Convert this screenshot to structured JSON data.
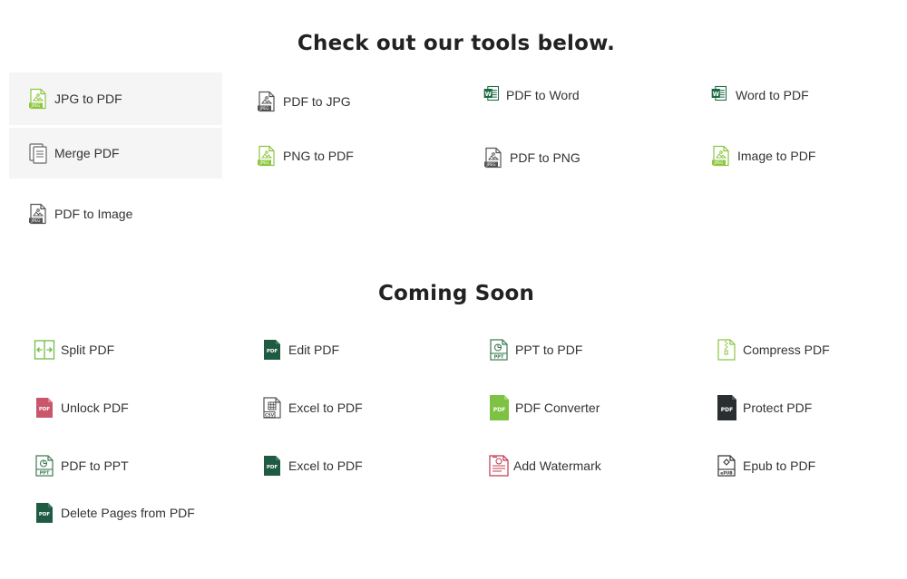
{
  "tools_heading": "Check out our tools below.",
  "soon_heading": "Coming Soon",
  "tools": [
    {
      "label": "JPG to PDF",
      "icon": "jpeg-file-icon"
    },
    {
      "label": "PDF to JPG",
      "icon": "jpeg-file-icon"
    },
    {
      "label": "PDF to Word",
      "icon": "word-doc-icon"
    },
    {
      "label": "Word to PDF",
      "icon": "word-doc-icon"
    },
    {
      "label": "Merge PDF",
      "icon": "merge-documents-icon"
    },
    {
      "label": "PNG to PDF",
      "icon": "jpeg-file-icon"
    },
    {
      "label": "PDF to PNG",
      "icon": "jpeg-file-icon"
    },
    {
      "label": "Image to PDF",
      "icon": "jpeg-file-icon"
    },
    {
      "label": "PDF to Image",
      "icon": "jpeg-file-icon"
    }
  ],
  "coming_soon": [
    {
      "label": "Split PDF",
      "icon": "split-arrows-icon"
    },
    {
      "label": "Edit PDF",
      "icon": "pdf-file-icon"
    },
    {
      "label": "PPT to PDF",
      "icon": "ppt-file-icon"
    },
    {
      "label": "Compress PDF",
      "icon": "zip-file-icon"
    },
    {
      "label": "Unlock PDF",
      "icon": "pdf-file-icon"
    },
    {
      "label": "Excel to PDF",
      "icon": "excel-sheet-icon"
    },
    {
      "label": "PDF Converter",
      "icon": "pdf-file-icon"
    },
    {
      "label": "Protect PDF",
      "icon": "pdf-file-icon"
    },
    {
      "label": "PDF to PPT",
      "icon": "ppt-file-icon"
    },
    {
      "label": "Excel to PDF",
      "icon": "pdf-file-icon"
    },
    {
      "label": "Add Watermark",
      "icon": "watermark-doc-icon"
    },
    {
      "label": "Epub to PDF",
      "icon": "epub-file-icon"
    },
    {
      "label": "Delete Pages from PDF",
      "icon": "pdf-file-icon"
    }
  ],
  "colors": {
    "jpeg_green": "#8cc63f",
    "jpeg_gray": "#555555",
    "word_green": "#1e6b43",
    "pdf_dark_green": "#1f5b43",
    "pdf_red": "#c9566a",
    "pdf_light_green": "#7dc242",
    "pdf_charcoal": "#2b2e31",
    "watermark_red": "#c0394f"
  },
  "icon_labels": {
    "jpeg": "JPEG",
    "pdf": "PDF",
    "ppt": "PPT",
    "csv": "CSV",
    "epub": "ePUB",
    "word": "W"
  }
}
